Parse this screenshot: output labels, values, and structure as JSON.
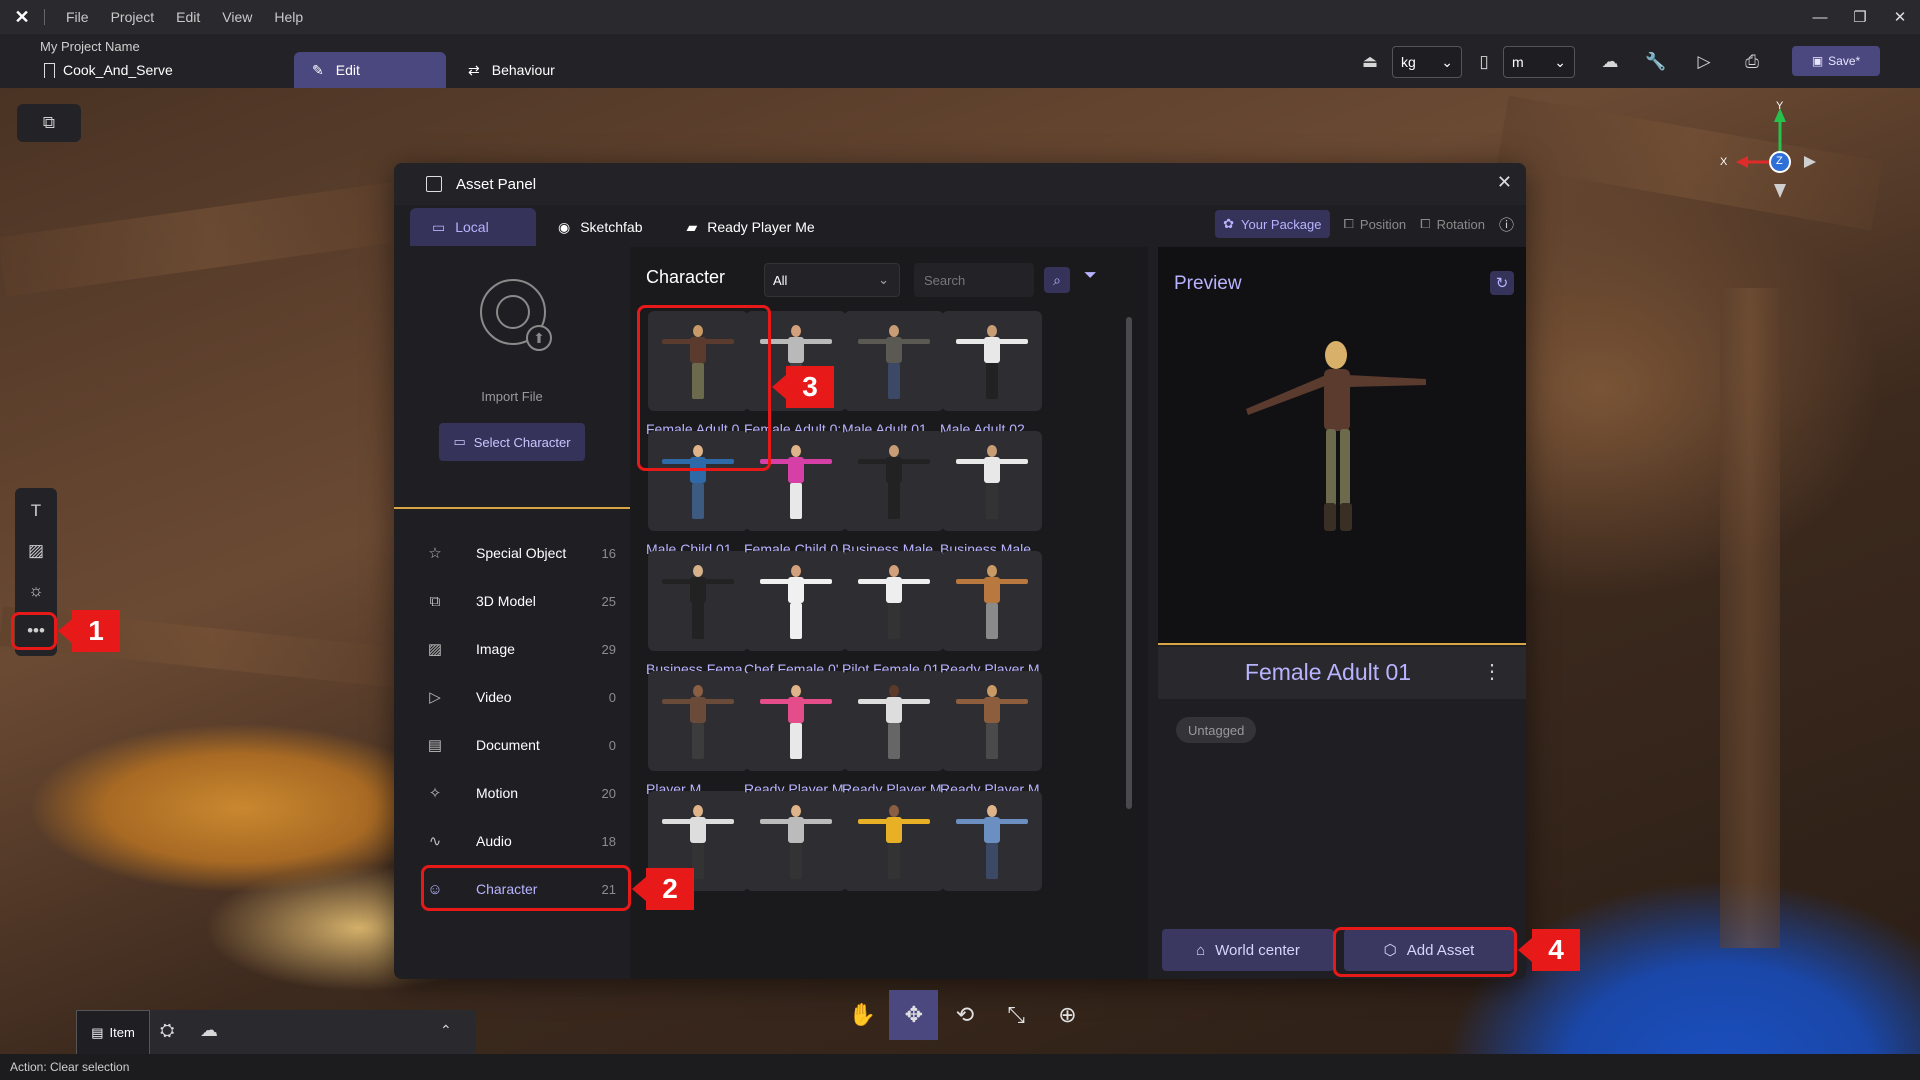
{
  "menu": [
    "File",
    "Project",
    "Edit",
    "View",
    "Help"
  ],
  "window_controls": [
    "minimize-icon",
    "restore-icon",
    "close-icon"
  ],
  "project": {
    "label": "My Project Name",
    "name": "Cook_And_Serve"
  },
  "modes": {
    "edit": "Edit",
    "behaviour": "Behaviour"
  },
  "units": {
    "mass": "kg",
    "length": "m"
  },
  "save_label": "Save*",
  "gizmo": {
    "x": "X",
    "y": "Y",
    "z": "Z"
  },
  "panel": {
    "title": "Asset Panel",
    "tabs": [
      "Local",
      "Sketchfab",
      "Ready Player Me"
    ],
    "your_package": "Your Package",
    "position": "Position",
    "rotation": "Rotation",
    "import_label": "Import File",
    "select_character": "Select Character",
    "categories": [
      {
        "name": "Special Object",
        "count": "16",
        "icon": "star-icon"
      },
      {
        "name": "3D Model",
        "count": "25",
        "icon": "cube-icon"
      },
      {
        "name": "Image",
        "count": "29",
        "icon": "image-icon"
      },
      {
        "name": "Video",
        "count": "0",
        "icon": "play-icon"
      },
      {
        "name": "Document",
        "count": "0",
        "icon": "document-icon"
      },
      {
        "name": "Motion",
        "count": "20",
        "icon": "motion-icon"
      },
      {
        "name": "Audio",
        "count": "18",
        "icon": "audio-icon"
      },
      {
        "name": "Character",
        "count": "21",
        "icon": "character-icon"
      }
    ],
    "grid_title": "Character",
    "filter_value": "All",
    "search_placeholder": "Search",
    "assets": [
      "Female Adult 0",
      "Female Adult 0:",
      "Male Adult 01",
      "Male Adult 02",
      "Male Child 01",
      "Female Child 0",
      "Business Male",
      "Business Male",
      "Business Fema",
      "Chef Female 0'",
      "Pilot Female 01",
      "Ready Player M",
      "Player M",
      "Ready Player M",
      "Ready Player M",
      "Ready Player M",
      "",
      "",
      "",
      ""
    ],
    "preview": {
      "title": "Preview",
      "name": "Female Adult 01",
      "tag": "Untagged",
      "world_center": "World center",
      "add_asset": "Add Asset"
    }
  },
  "callouts": [
    "1",
    "2",
    "3",
    "4"
  ],
  "bottom": {
    "item_tab": "Item"
  },
  "status": "Action: Clear selection"
}
